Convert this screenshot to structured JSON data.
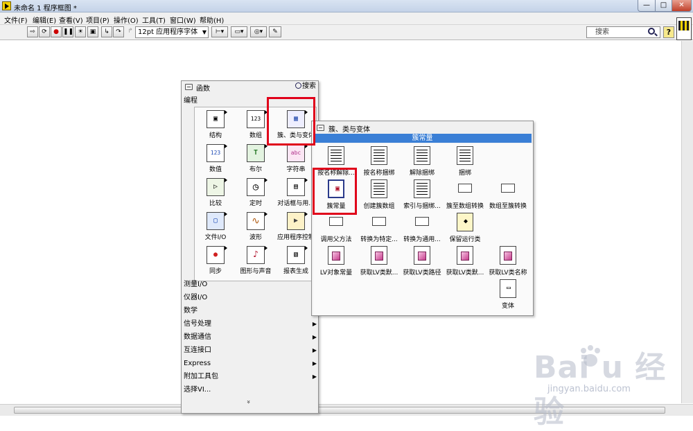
{
  "window": {
    "title": "未命名 1 程序框图 *",
    "minimize": "—",
    "maximize": "□",
    "close": "✕"
  },
  "menu": [
    "文件(F)",
    "编辑(E)",
    "查看(V)",
    "项目(P)",
    "操作(O)",
    "工具(T)",
    "窗口(W)",
    "帮助(H)"
  ],
  "toolbar": {
    "font_select": "12pt 应用程序字体",
    "search_placeholder": "搜索",
    "help": "?"
  },
  "functions_palette": {
    "title": "函数",
    "search_label": "搜索",
    "category": "编程",
    "items": [
      {
        "label": "结构",
        "glyph": "▣"
      },
      {
        "label": "数组",
        "glyph": "123"
      },
      {
        "label": "簇、类与变体",
        "glyph": "▦"
      },
      {
        "label": "数值",
        "glyph": "123"
      },
      {
        "label": "布尔",
        "glyph": "T"
      },
      {
        "label": "字符串",
        "glyph": "abc"
      },
      {
        "label": "比较",
        "glyph": "▷"
      },
      {
        "label": "定时",
        "glyph": "◷"
      },
      {
        "label": "对话框与用...",
        "glyph": "▤"
      },
      {
        "label": "文件I/O",
        "glyph": "▢"
      },
      {
        "label": "波形",
        "glyph": "∿"
      },
      {
        "label": "应用程序控制",
        "glyph": "▶"
      },
      {
        "label": "同步",
        "glyph": "●"
      },
      {
        "label": "图形与声音",
        "glyph": "♪"
      },
      {
        "label": "报表生成",
        "glyph": "▧"
      }
    ],
    "categories": [
      {
        "label": "测量I/O",
        "arrow": ""
      },
      {
        "label": "仪器I/O",
        "arrow": ""
      },
      {
        "label": "数学",
        "arrow": ""
      },
      {
        "label": "信号处理",
        "arrow": "▶"
      },
      {
        "label": "数据通信",
        "arrow": "▶"
      },
      {
        "label": "互连接口",
        "arrow": "▶"
      },
      {
        "label": "Express",
        "arrow": "▶"
      },
      {
        "label": "附加工具包",
        "arrow": "▶"
      },
      {
        "label": "选择VI...",
        "arrow": ""
      }
    ],
    "more": "»"
  },
  "cluster_palette": {
    "title": "簇、类与变体",
    "subheader": "簇常量",
    "items": [
      {
        "label": "按名称解除...",
        "glyph": "comp"
      },
      {
        "label": "按名称捆绑",
        "glyph": "comp"
      },
      {
        "label": "解除捆绑",
        "glyph": "▥"
      },
      {
        "label": "捆绑",
        "glyph": "▥"
      },
      {
        "label": "簇常量",
        "glyph": "▣"
      },
      {
        "label": "创建簇数组",
        "glyph": "▦"
      },
      {
        "label": "索引与捆绑...",
        "glyph": "▦"
      },
      {
        "label": "簇至数组转换",
        "glyph": "▭"
      },
      {
        "label": "数组至簇转换",
        "glyph": "▭"
      },
      {
        "label": "调用父方法",
        "glyph": "▣"
      },
      {
        "label": "转换为特定...",
        "glyph": "▭"
      },
      {
        "label": "转换为通用...",
        "glyph": "▭"
      },
      {
        "label": "保留运行类",
        "glyph": "◆"
      },
      {
        "label": "LV对象常量",
        "glyph": "■"
      },
      {
        "label": "获取LV类默...",
        "glyph": "■"
      },
      {
        "label": "获取LV类路径",
        "glyph": "■"
      },
      {
        "label": "获取LV类默...",
        "glyph": "■"
      },
      {
        "label": "获取LV类名称",
        "glyph": "■"
      },
      {
        "label": "变体",
        "glyph": "▭"
      }
    ]
  },
  "watermark": {
    "logo": "Bai  u 经验",
    "url": "jingyan.baidu.com"
  }
}
